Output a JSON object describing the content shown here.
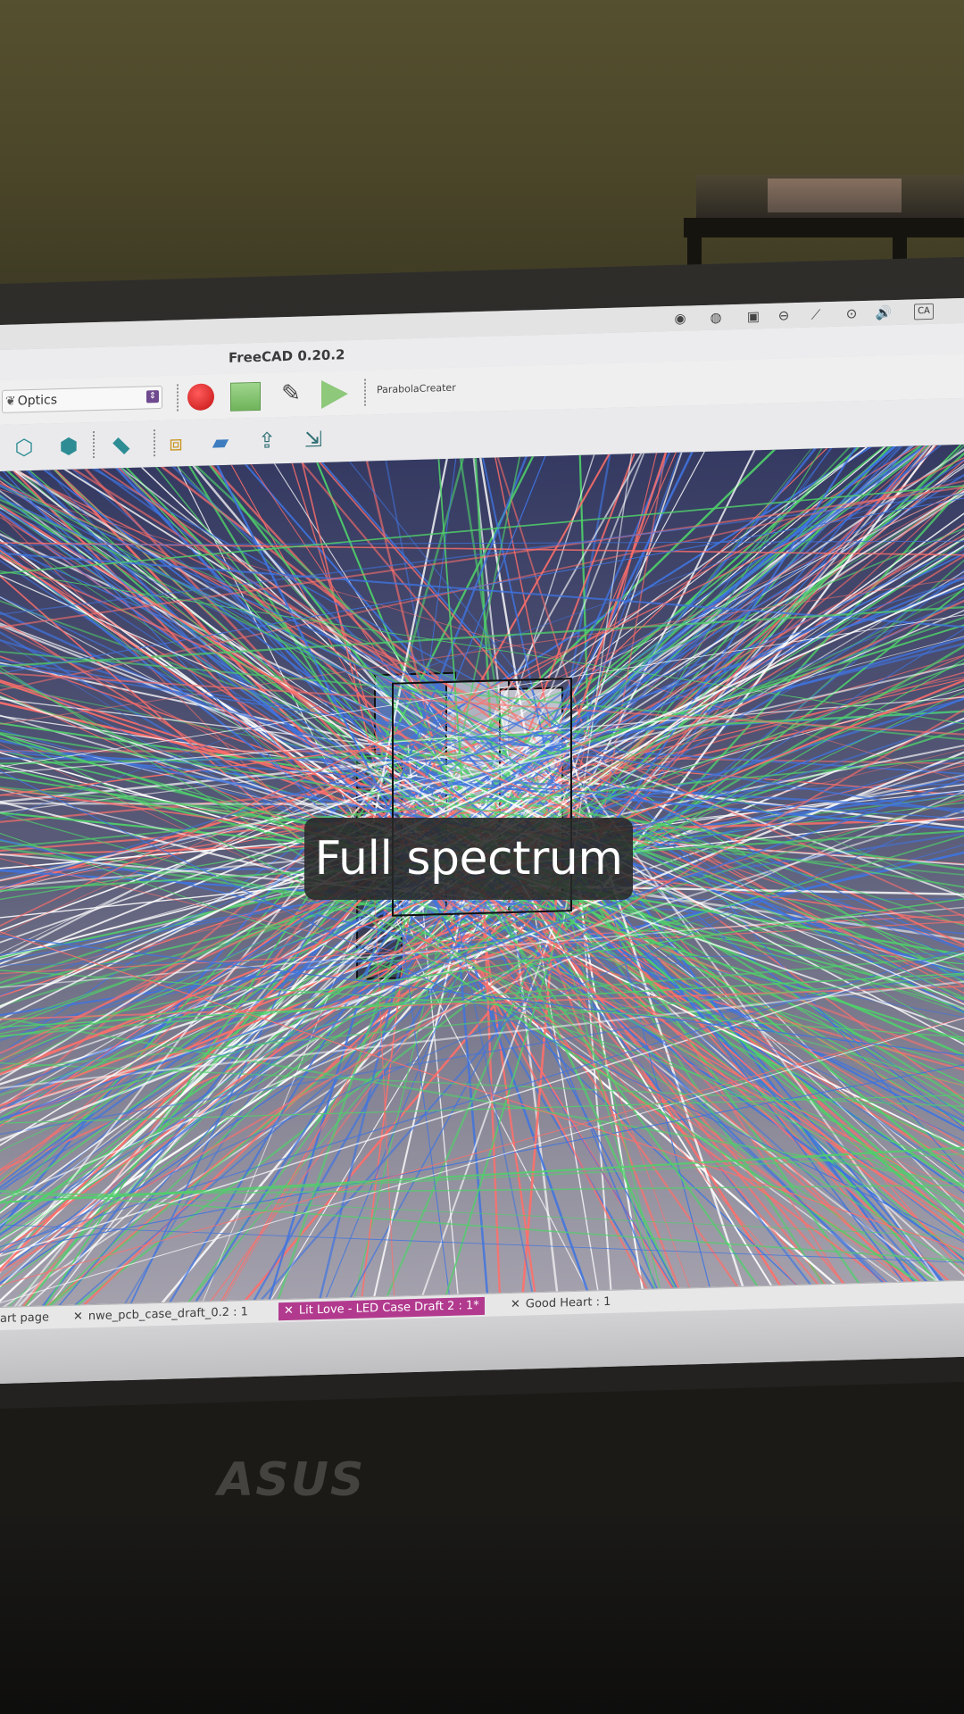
{
  "app": {
    "window_title": "FreeCAD 0.20.2"
  },
  "toolbar": {
    "workbench_selected": "Optics",
    "macro_name": "ParabolaCreater"
  },
  "system_tray": {
    "icons": [
      "app-circle-icon",
      "app-circle-icon",
      "clipboard-icon",
      "sync-icon",
      "network-icon",
      "media-icon",
      "volume-icon",
      "CA"
    ],
    "keyboard_layout": "CA"
  },
  "tabs": [
    {
      "label": "art page",
      "active": false,
      "closable": false
    },
    {
      "label": "nwe_pcb_case_draft_0.2 : 1",
      "active": false,
      "closable": true
    },
    {
      "label": "Lit Love - LED Case Draft 2 : 1*",
      "active": true,
      "closable": true
    },
    {
      "label": "Good Heart : 1",
      "active": false,
      "closable": true
    }
  ],
  "viewport": {
    "content": "ray-trace",
    "ray_colors": [
      "#ffffff",
      "#ff6f6a",
      "#4fd06a",
      "#3f74e0"
    ]
  },
  "caption": {
    "text": "Full spectrum"
  },
  "laptop": {
    "brand": "ASUS"
  },
  "colors": {
    "active_tab": "#b23a8e",
    "record": "#d01f1f",
    "stop": "#7fc46b",
    "play": "#8ec87a"
  }
}
